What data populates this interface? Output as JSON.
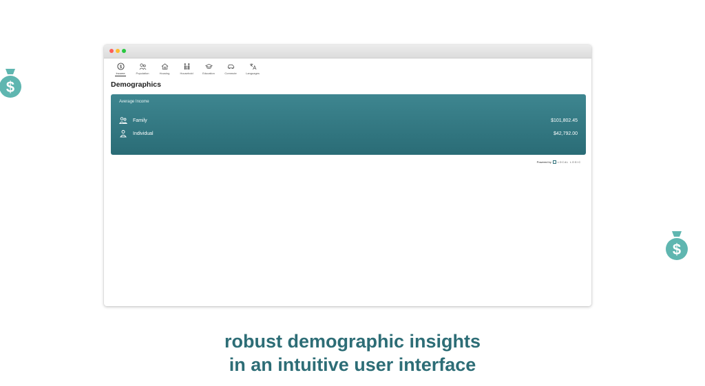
{
  "window": {
    "controls": [
      "close",
      "minimize",
      "maximize"
    ]
  },
  "tabs": [
    {
      "label": "Income",
      "icon": "dollar-circle-icon",
      "active": true
    },
    {
      "label": "Population",
      "icon": "people-icon"
    },
    {
      "label": "Housing",
      "icon": "house-icon"
    },
    {
      "label": "Household",
      "icon": "family-icon"
    },
    {
      "label": "Education",
      "icon": "graduation-cap-icon"
    },
    {
      "label": "Commute",
      "icon": "car-icon"
    },
    {
      "label": "Languages",
      "icon": "translate-icon"
    }
  ],
  "page": {
    "title": "Demographics"
  },
  "income_card": {
    "title": "Average Income",
    "rows": [
      {
        "label": "Family",
        "value": "$101,802.45",
        "icon": "family-icon"
      },
      {
        "label": "Individual",
        "value": "$42,792.00",
        "icon": "person-icon"
      }
    ]
  },
  "footer": {
    "powered_by": "Powered by",
    "brand": "LOCAL LOGIC"
  },
  "caption": {
    "line1": "robust demographic insights",
    "line2": "in an intuitive user interface"
  },
  "colors": {
    "accent": "#2f7680",
    "caption": "#2d6d76",
    "moneybag": "#5fb6b0"
  }
}
